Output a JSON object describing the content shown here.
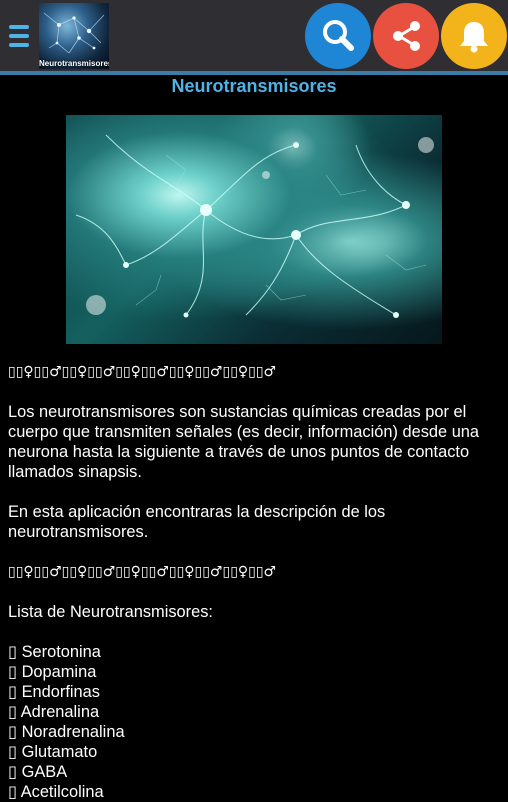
{
  "app": {
    "logo_text": "Neurotransmisores",
    "icons": {
      "menu": "menu-icon",
      "search": "search-icon",
      "share": "share-icon",
      "bell": "bell-icon"
    },
    "colors": {
      "topbar": "#2f2f33",
      "accent": "#4fb3e6",
      "search": "#1f86d6",
      "share": "#e8503f",
      "bell": "#f3b31a"
    }
  },
  "page": {
    "title": "Neurotransmisores",
    "decor_line_1": "▯▯♀▯▯♂▯▯♀▯▯♂▯▯♀▯▯♂▯▯♀▯▯♂▯▯♀▯▯♂",
    "intro_paragraph": "Los neurotransmisores son sustancias químicas creadas por el cuerpo que transmiten señales (es decir, información) desde una neurona hasta la siguiente a través de unos puntos de contacto llamados sinapsis.",
    "app_paragraph": "En esta aplicación encontraras la descripción de los neurotransmisores.",
    "decor_line_2": "▯▯♀▯▯♂▯▯♀▯▯♂▯▯♀▯▯♂▯▯♀▯▯♂▯▯♀▯▯♂",
    "list_heading": "Lista de Neurotransmisores:",
    "list_bullet": "▯",
    "list_items": [
      "Serotonina",
      "Dopamina",
      "Endorfinas",
      "Adrenalina",
      "Noradrenalina",
      "Glutamato",
      "GABA",
      "Acetilcolina"
    ]
  }
}
